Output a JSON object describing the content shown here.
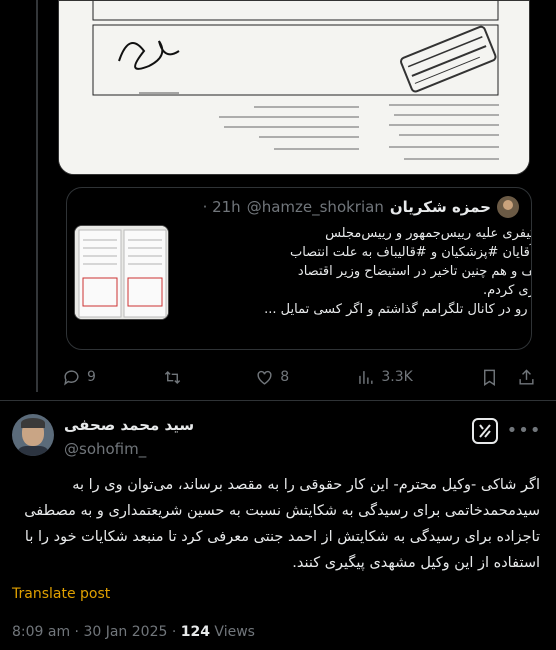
{
  "quoted": {
    "name": "حمزه شکریان",
    "handle": "@hamze_shokrian",
    "time": "· 21h",
    "lines": [
      "شکایت کیفری علیه رییس‌جمهور و رییس‌مجلس",
      "امروز علیه آقایان #پزشکیان و #قالیباف به علت انتصاب",
      "آقای #ظریف و هم چنین تاخیر در استیضاح وزیر اقتصاد",
      "شکایت کیفری کردم.",
      "متن شکایت رو در کانال تلگرامم گذاشتم و اگر کسی تمایل ..."
    ]
  },
  "actions": {
    "replies": "9",
    "retweets": "",
    "likes": "8",
    "views": "3.3K"
  },
  "post": {
    "author_name": "سید محمد صحفی",
    "author_handle": "@sohofim_",
    "lines": [
      "اگر شاکی -وکیل محترم- این کار حقوقی را به مقصد برساند، می‌توان وی را به",
      "سیدمحمدخاتمی برای رسیدگی به شکایتش نسبت به حسین شریعتمداری و به مصطفی",
      "تاجزاده برای رسیدگی به شکایتش از احمد جنتی معرفی کرد تا منبعد شکایات خود را با",
      "استفاده از این وکیل مشهدی پیگیری کنند."
    ],
    "translate_label": "Translate post",
    "timestamp": "8:09 am · 30 Jan 2025 · ",
    "views_count": "124",
    "views_label": " Views"
  }
}
